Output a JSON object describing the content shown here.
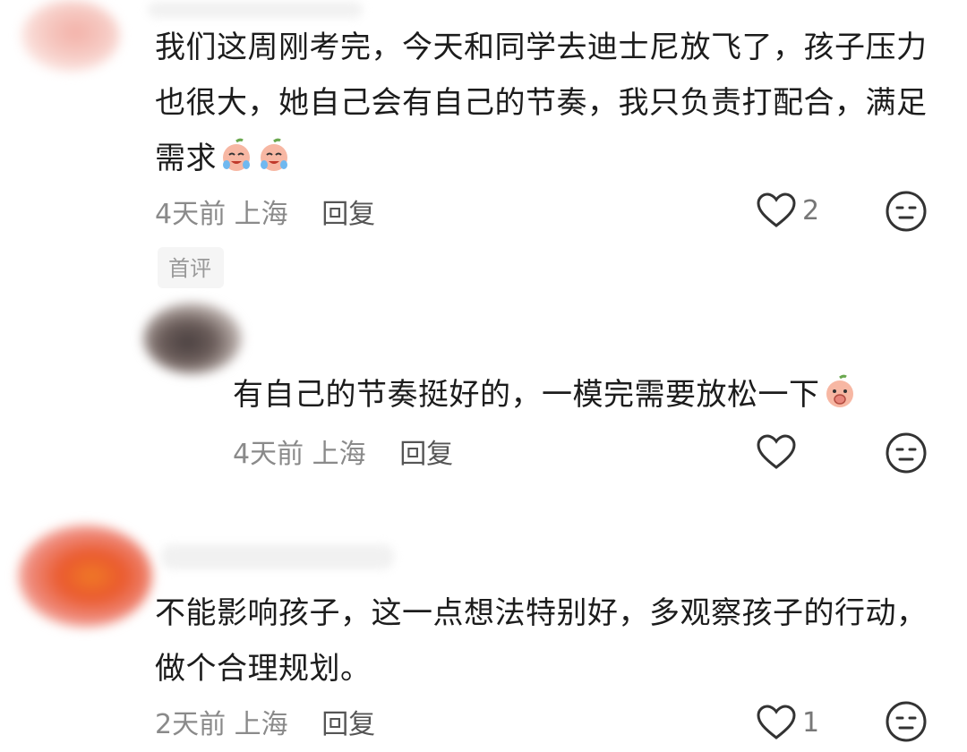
{
  "comments": [
    {
      "text": "我们这周刚考完，今天和同学去迪士尼放飞了，孩子压力也很大，她自己会有自己的节奏，我只负责打配合，满足需求",
      "emojis": [
        "crying-laugh-emoji",
        "crying-laugh-emoji"
      ],
      "time": "4天前",
      "location": "上海",
      "reply_label": "回复",
      "likes": "2"
    },
    {
      "badge": "首评",
      "text": "有自己的节奏挺好的，一模完需要放松一下",
      "emojis": [
        "covering-mouth-emoji"
      ],
      "time": "4天前",
      "location": "上海",
      "reply_label": "回复",
      "likes": ""
    },
    {
      "text": "不能影响孩子，这一点想法特别好，多观察孩子的行动，做个合理规划。",
      "emojis": [],
      "time": "2天前",
      "location": "上海",
      "reply_label": "回复",
      "likes": "1"
    }
  ],
  "icons": {
    "like": "heart-outline-icon",
    "dislike": "neutral-face-icon"
  },
  "colors": {
    "text": "#1c1c1c",
    "meta": "#8a8a8a",
    "icon": "#333333"
  }
}
